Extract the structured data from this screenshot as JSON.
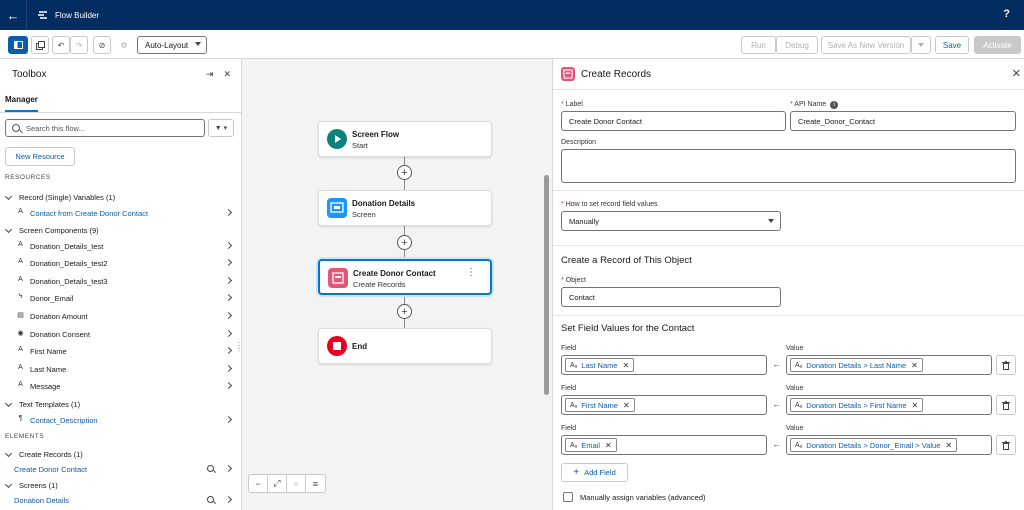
{
  "topbar": {
    "app_title": "Flow Builder",
    "help_label": "?"
  },
  "toolbar": {
    "layout_select": "Auto-Layout",
    "run_label": "Run",
    "debug_label": "Debug",
    "save_as_label": "Save As New Version",
    "save_label": "Save",
    "activate_label": "Activate"
  },
  "toolbox": {
    "title": "Toolbox",
    "tab": "Manager",
    "search_placeholder": "Search this flow...",
    "new_resource": "New Resource",
    "resources_label": "RESOURCES",
    "groups": [
      {
        "label": "Record (Single) Variables (1)",
        "items": [
          {
            "icon": "A",
            "label": "Contact from Create Donor Contact",
            "link": true
          }
        ]
      },
      {
        "label": "Screen Components (9)",
        "items": [
          {
            "icon": "A",
            "label": "Donation_Details_test",
            "link": false
          },
          {
            "icon": "A",
            "label": "Donation_Details_test2",
            "link": false
          },
          {
            "icon": "A",
            "label": "Donation_Details_test3",
            "link": false
          },
          {
            "icon": "ϟ",
            "label": "Donor_Email",
            "link": false
          },
          {
            "icon": "▤",
            "label": "Donation Amount",
            "link": false
          },
          {
            "icon": "◉",
            "label": "Donation Consent",
            "link": false
          },
          {
            "icon": "A",
            "label": "First Name",
            "link": false
          },
          {
            "icon": "A",
            "label": "Last Name",
            "link": false
          },
          {
            "icon": "A",
            "label": "Message",
            "link": false
          }
        ]
      },
      {
        "label": "Text Templates (1)",
        "items": [
          {
            "icon": "¶",
            "label": "Contact_Description",
            "link": true
          }
        ]
      }
    ],
    "elements_label": "ELEMENTS",
    "element_groups": [
      {
        "label": "Create Records (1)",
        "item": "Create Donor Contact"
      },
      {
        "label": "Screens (1)",
        "item": "Donation Details"
      }
    ]
  },
  "canvas": {
    "nodes": [
      {
        "title": "Screen Flow",
        "subtitle": "Start"
      },
      {
        "title": "Donation Details",
        "subtitle": "Screen"
      },
      {
        "title": "Create Donor Contact",
        "subtitle": "Create Records"
      },
      {
        "title": "End",
        "subtitle": ""
      }
    ]
  },
  "panel": {
    "title": "Create Records",
    "label_label": "Label",
    "label_value": "Create Donor Contact",
    "api_label": "API Name",
    "api_value": "Create_Donor_Contact",
    "description_label": "Description",
    "how_label": "How to set record field values",
    "how_value": "Manually",
    "object_section": "Create a Record of This Object",
    "object_label": "Object",
    "object_value": "Contact",
    "field_section": "Set Field Values for the Contact",
    "field_label": "Field",
    "value_label": "Value",
    "rows": [
      {
        "field": "Last Name",
        "value": "Donation Details > Last Name"
      },
      {
        "field": "First Name",
        "value": "Donation Details > First Name"
      },
      {
        "field": "Email",
        "value": "Donation Details > Donor_Email > Value"
      }
    ],
    "add_field": "Add Field",
    "manual_assign": "Manually assign variables (advanced)"
  },
  "colors": {
    "topbar": "#032d60",
    "brand_blue": "#0176d3",
    "create_records_icon": "#e3567a",
    "start_icon": "#0b827c",
    "screen_icon": "#1b96ff",
    "end_icon": "#ea001e"
  }
}
